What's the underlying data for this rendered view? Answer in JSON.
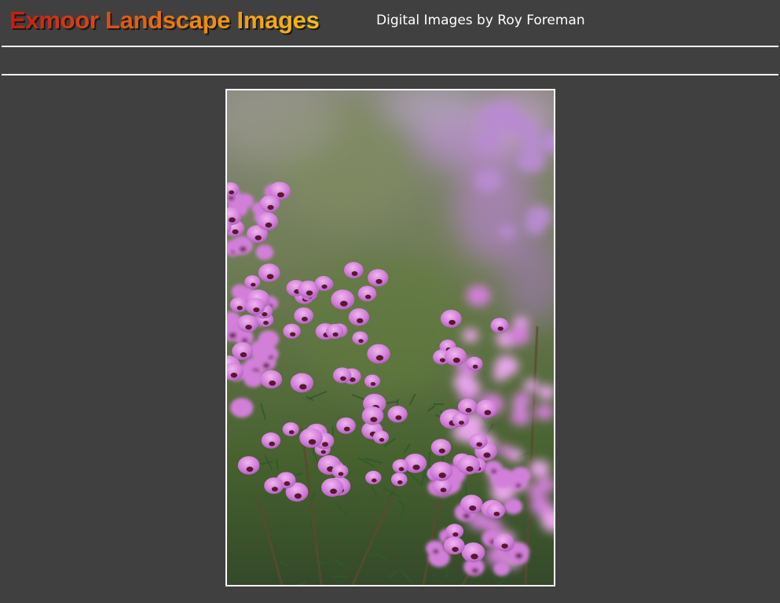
{
  "header": {
    "title": "Exmoor Landscape Images",
    "subtitle": "Digital Images by Roy Foreman"
  },
  "colors": {
    "background": "#404040",
    "rule": "#f2f2f2",
    "title_gradient": [
      "#c81a10",
      "#ee8a10",
      "#f6bd16"
    ],
    "frame_border": "#ffffff"
  },
  "photo": {
    "subject": "pink heather flowers",
    "colors": {
      "bg_top": "#8b8a80",
      "bg_mid": "#6f7c55",
      "bg_bottom": "#39502a",
      "bloom": "#d27fd9",
      "bloom_light": "#e8a6ea",
      "bloom_dark": "#a95cb5",
      "throat": "#5a1830",
      "leaf": "#2f5a2a"
    }
  }
}
